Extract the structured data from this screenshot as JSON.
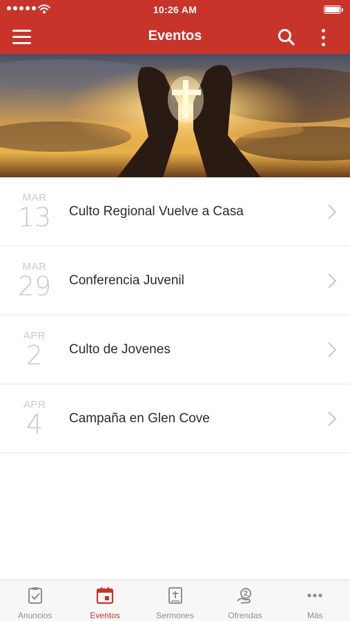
{
  "status_bar": {
    "time": "10:26 AM",
    "signal_icon": "signal-dots-icon",
    "wifi_icon": "wifi-icon",
    "battery_icon": "battery-full-icon"
  },
  "nav_bar": {
    "title": "Eventos",
    "menu_icon": "hamburger-menu-icon",
    "search_icon": "search-icon",
    "more_icon": "vertical-ellipsis-icon",
    "background_color": "#c8342a"
  },
  "hero": {
    "image": "hands-holding-cross-sunset"
  },
  "events": [
    {
      "month": "MAR",
      "day": "13",
      "title": "Culto Regional Vuelve a Casa"
    },
    {
      "month": "MAR",
      "day": "29",
      "title": "Conferencia Juvenil"
    },
    {
      "month": "APR",
      "day": "2",
      "title": "Culto de Jovenes"
    },
    {
      "month": "APR",
      "day": "4",
      "title": "Campaña en Glen Cove"
    }
  ],
  "tab_bar": {
    "tabs": [
      {
        "label": "Anuncios",
        "icon": "clipboard-check-icon",
        "active": false
      },
      {
        "label": "Eventos",
        "icon": "calendar-icon",
        "active": true
      },
      {
        "label": "Sermones",
        "icon": "bible-icon",
        "active": false
      },
      {
        "label": "Ofrendas",
        "icon": "offering-hand-icon",
        "active": false
      },
      {
        "label": "Más",
        "icon": "more-dots-icon",
        "active": false
      }
    ],
    "active_color": "#c8342a",
    "inactive_color": "#8e8e8e"
  }
}
